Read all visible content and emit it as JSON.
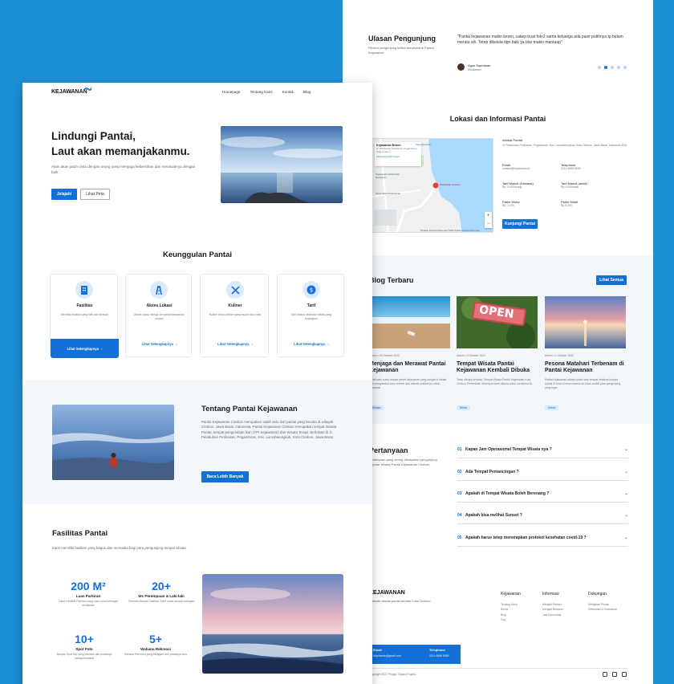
{
  "back": {
    "reviews": {
      "title": "Ulasan Pengunjung",
      "subtitle": "Review pengunjung ketika berwisata di Pantai Kejawanan",
      "quote": "\"Pantai kejawanan makin keren, cakep buat foto2 sama keluarga ada pasir putihnya tp belum merata sih. Tetep dikelola dgn baik ya biar makin mantaap\"",
      "reviewer_name": "Agus Suprianan",
      "reviewer_role": "Wisatawan"
    },
    "location": {
      "title": "Lokasi dan Informasi Pantai",
      "map_place": "Kejawanan Beach",
      "map_address": "Jl. Pelabuhan Perikanan, Pegambiran, Kota Cirebon",
      "map_link": "Lihat peta lebih besar",
      "map_directions": "Petunjuk Arah",
      "map_label_1": "Kejawanan Pelabuhan Perikanan",
      "map_label_2": "Pelabuhan Cirebon",
      "map_label_3": "Perumahan Kejawanan",
      "map_footer": "Pintasan keyboard   Data peta ©2022   Syarat   Laporkan error peta",
      "zoom_in": "+",
      "zoom_out": "−",
      "address_label": "Alamat Pantai",
      "address_value": "Jl. Pelabuhan Perikanan, Pegambiran, Kec. Lemahwungkuk, Kota Cirebon, Jawa Barat, Indonesia 4511",
      "email_label": "Email",
      "email_value": "contact@kejawanan.id",
      "phone_label": "Telephone",
      "phone_value": "0214 6666 8989",
      "tarif_dewasa_label": "Tarif Masuk (Dewasa)",
      "tarif_dewasa_value": "Rp. 5.000/orang",
      "tarif_anak_label": "Tarif Masuk (anak)",
      "tarif_anak_value": "Rp 4.000/anak",
      "parkir_motor_label": "Parkir Motor",
      "parkir_motor_value": "Rp. 2.000",
      "parkir_mobil_label": "Parkir Mobil",
      "parkir_mobil_value": "Rp 5.000",
      "button": "Kunjungi Pantai"
    },
    "blog": {
      "title": "Blog Terbaru",
      "button": "Lihat Semua",
      "posts": [
        {
          "meta": "Admin • 18 Oktober 2022",
          "title": "Menjaga dan Merawat Pantai Kejawanan",
          "excerpt": "Salah satu sudut wisata pantai kejawanan yang sangat di minati oleh masyarakat kota cirebon dan daerah sekitarnya untuk bersantai",
          "tag": "Wisata"
        },
        {
          "meta": "Admin • 9 Oktober 2022",
          "title": "Tempat Wisata Pantai Kejawanan Kembali Dibuka",
          "excerpt": "Tentu dibuka kembali, Tempat Wisata Pantai Kejawanan Kota Cirebon Pemerintah Setempat telah dibuka untuk membuka ke",
          "tag": "Berita",
          "sign": "OPEN"
        },
        {
          "meta": "Admin • 1 Oktober 2022",
          "title": "Pesona Matahari Terbenam di Pantai Kejawanan",
          "excerpt": "Pantai Kejawanan adalah salah satu tempat destinasi wisata pantai di Kota Cirebon karena itu tidak sedikit para pengunjung yang ingin",
          "tag": "Artikel"
        }
      ]
    },
    "faq": {
      "title": "Pertanyaan",
      "subtitle": "Pertanyaan yang sering ditanyakan pengunjung seputar Wisata Pantai Kejawanan Cirebon.",
      "items": [
        {
          "num": "01",
          "q": "Kapan Jam Operasional Tempat Wisata nya ?"
        },
        {
          "num": "02",
          "q": "Ada Tempat Pemancingan ?"
        },
        {
          "num": "03",
          "q": "Apakah di Tempat Wisata Boleh Berenang ?"
        },
        {
          "num": "04",
          "q": "Apakah bisa melihat  Sunset ?"
        },
        {
          "num": "05",
          "q": "Apakah harus tetep menerapkan protokol kesehatan covid-19 ?"
        }
      ]
    },
    "footer": {
      "logo": "KEJAWANAN",
      "tagline": "Website wisata pantai terbaik Kota Cirebon",
      "col1_title": "Kejawanan",
      "col1_items": [
        "Tentang Kami",
        "Berita",
        "Blog",
        "Faq"
      ],
      "col2_title": "Informasi",
      "col2_items": [
        "Menjadi Partner",
        "Menjadi Relawan",
        "Jadi Komunitas"
      ],
      "col3_title": "Dukungan",
      "col3_items": [
        "Kebijakan Privasi",
        "Ketentuan & Keamanan"
      ],
      "email_label": "Email",
      "email_value": "kejawanan@gmail.com",
      "phone_label": "Telephone",
      "phone_value": "0214 6666 8989",
      "copyright": "Copyright 2022 Pinggir Segara Project"
    }
  },
  "front": {
    "nav": {
      "logo": "KEJAWANAN",
      "links": [
        "Homepage",
        "Tentang Kami",
        "Kontak",
        "Blog"
      ]
    },
    "hero": {
      "title_line1": "Lindungi Pantai,",
      "title_line2": "Laut akan memanjakanmu.",
      "desc": "Alam akan jatuh cinta dengan orang yang menjaga kebersihan dan merawatnya dengan baik",
      "btn_primary": "Jelajahi",
      "btn_secondary": "Lihat Peta"
    },
    "features": {
      "title": "Keunggulan Pantai",
      "cards": [
        {
          "title": "Fasilitas",
          "desc": "Memiliki fasilitas yang baik dan terawat",
          "link": "Lihat Selengkapnya",
          "icon": "building-icon",
          "active": true
        },
        {
          "title": "Akses  Lokasi",
          "desc": "Akses lokasi menuju ke pantai kejawanan mudah",
          "link": "Lihat Selengkapnya",
          "icon": "road-icon",
          "active": false
        },
        {
          "title": "Kuliner",
          "desc": "Kuliner khas cirebon yang murah dan enak",
          "link": "Lihat Selengkapnya",
          "icon": "utensils-icon",
          "active": false
        },
        {
          "title": "Tarif",
          "desc": "Tarif masuk destinasi wisata yang terjangkau",
          "link": "Lihat Selengkapnya",
          "icon": "coin-icon",
          "active": false
        }
      ]
    },
    "about": {
      "title": "Tentang Pantai Kejawanan",
      "desc": "Pantai Kejawanan Cirebon merupakan salah satu dari pantai yang berada di wilayah Cirebon, Jawa Barat, Indonesia. Pantai Kejawanan Cirebon merupakan tempat Wisata Pantai, tempat pengelolaan ikan (TPI Kejawanan) dan Wisata Terapi. Berlokasi di Jl. Pelabuhan Perikanan, Pegambiran, Kec. Lemahwungkuk, Kota Cirebon, Jawa Barat.",
      "button": "Baca Lebih Banyak"
    },
    "facilities": {
      "title": "Fasilitas Pantai",
      "desc": "Kami memiliki fasilitas yang bagus dan memadai bagi para pengunjung tempat wisata.",
      "stats": [
        {
          "value": "200 M²",
          "label": "Luas Parkiran",
          "desc": "Kami memiliki Parkiran yang luas untuk berbagai kendaraan"
        },
        {
          "value": "20+",
          "label": "Wc Perempuan & Laki-laki",
          "desc": "Tersedia Banyak Fasilitas Toilet untuk semua kalangan"
        },
        {
          "value": "10+",
          "label": "Spot Foto",
          "desc": "Banyak Spot foto yang menarik dan posisinya instagrammable"
        },
        {
          "value": "5+",
          "label": "Wahana Rekreasi",
          "desc": "Wahana Rekreasi yang beragam dan posisinya seru"
        }
      ]
    }
  },
  "colors": {
    "brand": "#1370d8",
    "background": "#1b8fd6",
    "light_section": "#f3f7fc"
  }
}
